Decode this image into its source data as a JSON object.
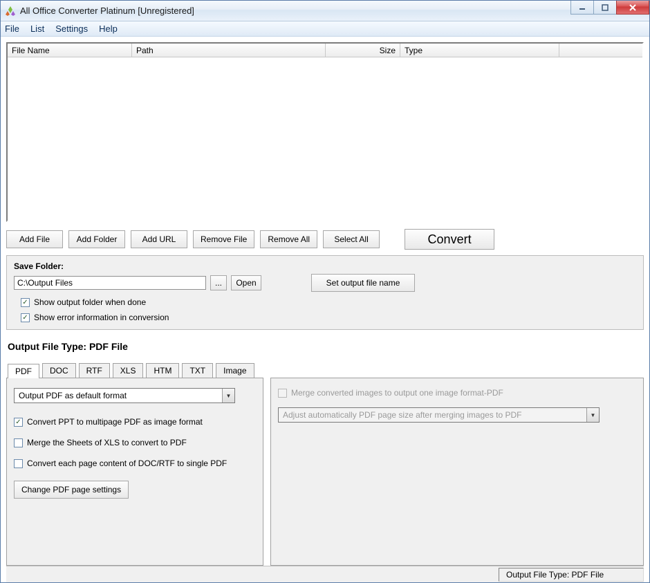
{
  "window": {
    "title": "All Office Converter Platinum [Unregistered]"
  },
  "menu": {
    "file": "File",
    "list": "List",
    "settings": "Settings",
    "help": "Help"
  },
  "columns": {
    "filename": "File Name",
    "path": "Path",
    "size": "Size",
    "type": "Type"
  },
  "toolbar": {
    "add_file": "Add File",
    "add_folder": "Add Folder",
    "add_url": "Add URL",
    "remove_file": "Remove File",
    "remove_all": "Remove All",
    "select_all": "Select All",
    "convert": "Convert"
  },
  "save": {
    "legend": "Save Folder:",
    "path": "C:\\Output Files",
    "browse": "...",
    "open": "Open",
    "set_name": "Set output file name",
    "show_folder": "Show output folder when done",
    "show_error": "Show error information in conversion"
  },
  "output": {
    "label": "Output File Type:  PDF File",
    "tabs": {
      "pdf": "PDF",
      "doc": "DOC",
      "rtf": "RTF",
      "xls": "XLS",
      "htm": "HTM",
      "txt": "TXT",
      "image": "Image"
    }
  },
  "pdf_panel": {
    "combo": "Output PDF as default format",
    "ppt_multipage": "Convert PPT to multipage PDF as image format",
    "merge_xls": "Merge the Sheets of XLS to convert to PDF",
    "doc_single": "Convert each page content of DOC/RTF to single PDF",
    "change_settings": "Change PDF page settings"
  },
  "merge_panel": {
    "merge_images": "Merge converted images to output one image format-PDF",
    "adjust_combo": "Adjust automatically PDF page size after merging images to PDF"
  },
  "status": {
    "text": "Output File Type:  PDF File"
  }
}
